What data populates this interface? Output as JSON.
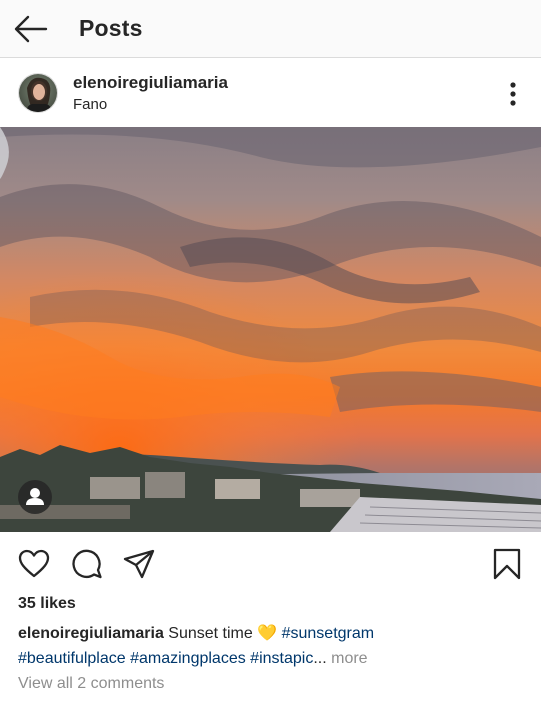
{
  "topbar": {
    "title": "Posts",
    "back_icon": "arrow-left-icon"
  },
  "post": {
    "username": "elenoiregiuliamaria",
    "location": "Fano",
    "more_icon": "vertical-ellipsis-icon",
    "photo_alt": "Sunset over the sea",
    "likes": "35 likes",
    "caption": {
      "username": "elenoiregiuliamaria",
      "text": "Sunset time",
      "emoji": "💛",
      "tags_line1": [
        "#sunsetgram"
      ],
      "tags_line2": [
        "#beautifulplace",
        "#amazingplaces",
        "#instapic"
      ],
      "ellipsis": "...",
      "more_label": "more"
    },
    "comments_link": "View all 2 comments"
  },
  "icons": {
    "like": "heart-icon",
    "comment": "comment-bubble-icon",
    "share": "paper-plane-icon",
    "save": "bookmark-icon",
    "tagged": "person-icon"
  },
  "colors": {
    "text": "#262626",
    "hashtag": "#00376b",
    "muted": "#8e8e8e",
    "bar_bg": "#fafafa",
    "divider": "#dbdbdb"
  }
}
